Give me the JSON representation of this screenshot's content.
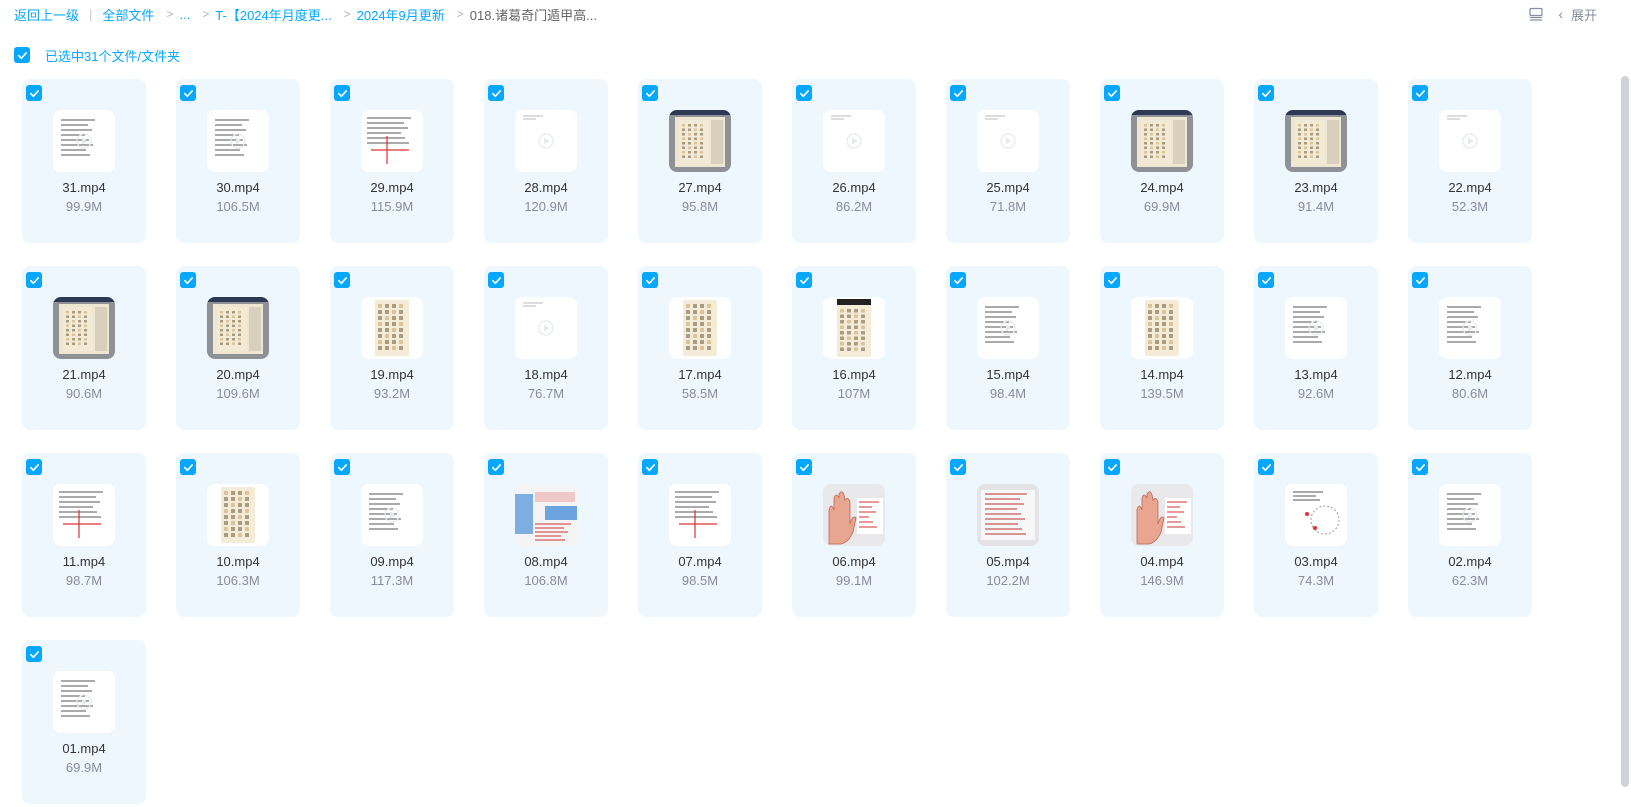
{
  "breadcrumb": {
    "back": "返回上一级",
    "all_files": "全部文件",
    "ellipsis": "...",
    "level1": "T-【2024年月度更...",
    "level2": "2024年9月更新",
    "current": "018.诸葛奇门遁甲高..."
  },
  "top_right": {
    "expand_label": "展开",
    "icons": [
      "list-view-icon",
      "chevron-left-icon"
    ]
  },
  "selection": {
    "label": "已选中31个文件/文件夹",
    "all_checked": true
  },
  "colors": {
    "accent": "#06a7ff",
    "card_bg": "#eef7fe"
  },
  "files": [
    {
      "name": "31.mp4",
      "size": "99.9M",
      "thumb": "doc"
    },
    {
      "name": "30.mp4",
      "size": "106.5M",
      "thumb": "doc"
    },
    {
      "name": "29.mp4",
      "size": "115.9M",
      "thumb": "doc-cross"
    },
    {
      "name": "28.mp4",
      "size": "120.9M",
      "thumb": "blank"
    },
    {
      "name": "27.mp4",
      "size": "95.8M",
      "thumb": "grid-frame"
    },
    {
      "name": "26.mp4",
      "size": "86.2M",
      "thumb": "blank"
    },
    {
      "name": "25.mp4",
      "size": "71.8M",
      "thumb": "blank"
    },
    {
      "name": "24.mp4",
      "size": "69.9M",
      "thumb": "grid-frame"
    },
    {
      "name": "23.mp4",
      "size": "91.4M",
      "thumb": "grid-frame"
    },
    {
      "name": "22.mp4",
      "size": "52.3M",
      "thumb": "blank"
    },
    {
      "name": "21.mp4",
      "size": "90.6M",
      "thumb": "grid-frame"
    },
    {
      "name": "20.mp4",
      "size": "109.6M",
      "thumb": "grid-frame"
    },
    {
      "name": "19.mp4",
      "size": "93.2M",
      "thumb": "grid-plain"
    },
    {
      "name": "18.mp4",
      "size": "76.7M",
      "thumb": "blank"
    },
    {
      "name": "17.mp4",
      "size": "58.5M",
      "thumb": "grid-plain"
    },
    {
      "name": "16.mp4",
      "size": "107M",
      "thumb": "grid-dark"
    },
    {
      "name": "15.mp4",
      "size": "98.4M",
      "thumb": "doc"
    },
    {
      "name": "14.mp4",
      "size": "139.5M",
      "thumb": "grid-plain"
    },
    {
      "name": "13.mp4",
      "size": "92.6M",
      "thumb": "doc"
    },
    {
      "name": "12.mp4",
      "size": "80.6M",
      "thumb": "doc"
    },
    {
      "name": "11.mp4",
      "size": "98.7M",
      "thumb": "doc-cross"
    },
    {
      "name": "10.mp4",
      "size": "106.3M",
      "thumb": "grid-plain"
    },
    {
      "name": "09.mp4",
      "size": "117.3M",
      "thumb": "doc"
    },
    {
      "name": "08.mp4",
      "size": "106.8M",
      "thumb": "slide"
    },
    {
      "name": "07.mp4",
      "size": "98.5M",
      "thumb": "doc-cross"
    },
    {
      "name": "06.mp4",
      "size": "99.1M",
      "thumb": "hand"
    },
    {
      "name": "05.mp4",
      "size": "102.2M",
      "thumb": "doc-red"
    },
    {
      "name": "04.mp4",
      "size": "146.9M",
      "thumb": "hand"
    },
    {
      "name": "03.mp4",
      "size": "74.3M",
      "thumb": "doc-circle"
    },
    {
      "name": "02.mp4",
      "size": "62.3M",
      "thumb": "doc"
    },
    {
      "name": "01.mp4",
      "size": "69.9M",
      "thumb": "doc"
    }
  ]
}
